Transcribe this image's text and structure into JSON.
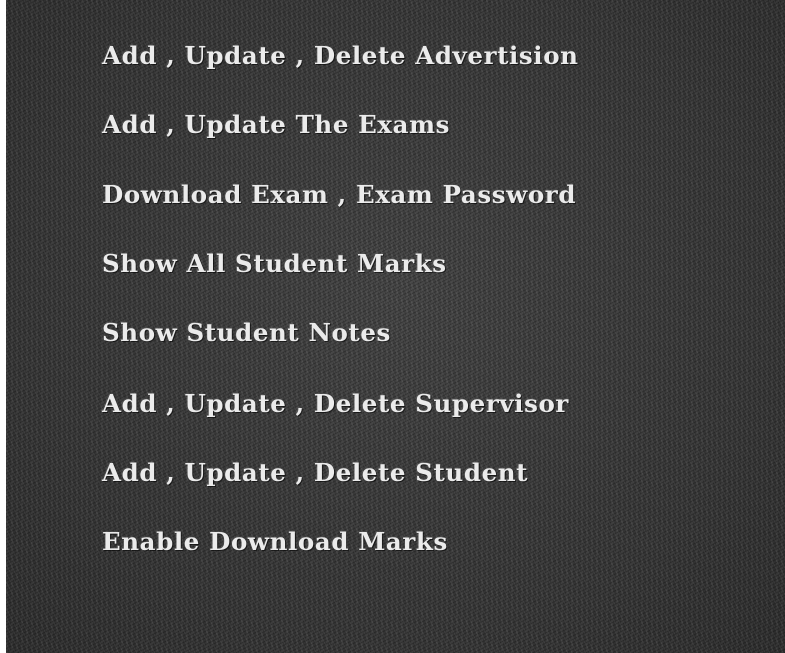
{
  "menu": {
    "items": [
      {
        "label": "Add , Update , Delete Advertision"
      },
      {
        "label": "Add , Update The Exams"
      },
      {
        "label": "Download Exam , Exam Password"
      },
      {
        "label": "Show All Student Marks"
      },
      {
        "label": "Show Student Notes"
      },
      {
        "label": "Add , Update , Delete Supervisor"
      },
      {
        "label": "Add , Update , Delete Student"
      },
      {
        "label": "Enable Download Marks"
      }
    ]
  },
  "colors": {
    "panel_background": "#3a3a3a",
    "text": "#ebebeb",
    "page_background": "#ffffff"
  }
}
